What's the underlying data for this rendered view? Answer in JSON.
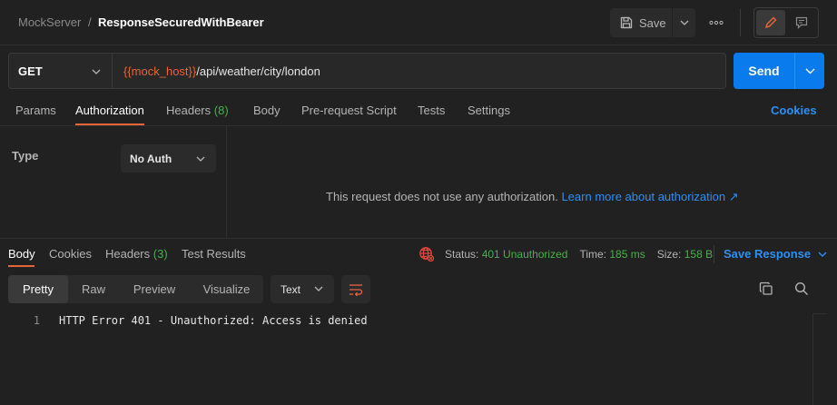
{
  "breadcrumb": {
    "parent": "MockServer",
    "separator": "/",
    "title": "ResponseSecuredWithBearer"
  },
  "header": {
    "save_label": "Save",
    "more_label": "∘∘∘"
  },
  "request": {
    "method": "GET",
    "url_variable": "{{mock_host}}",
    "url_path": "/api/weather/city/london",
    "send_label": "Send"
  },
  "request_tabs": {
    "params": "Params",
    "authorization": "Authorization",
    "headers": "Headers",
    "headers_count": "(8)",
    "body": "Body",
    "pre_request_script": "Pre-request Script",
    "tests": "Tests",
    "settings": "Settings",
    "cookies": "Cookies"
  },
  "auth": {
    "type_label": "Type",
    "type_value": "No Auth",
    "message": "This request does not use any authorization.",
    "learn_more": "Learn more about authorization ↗"
  },
  "response_tabs": {
    "body": "Body",
    "cookies": "Cookies",
    "headers": "Headers",
    "headers_count": "(3)",
    "test_results": "Test Results"
  },
  "response_status": {
    "status_label": "Status:",
    "status_value": "401 Unauthorized",
    "time_label": "Time:",
    "time_value": "185 ms",
    "size_label": "Size:",
    "size_value": "158 B",
    "save_response": "Save Response"
  },
  "format": {
    "pretty": "Pretty",
    "raw": "Raw",
    "preview": "Preview",
    "visualize": "Visualize",
    "language": "Text"
  },
  "response_body": {
    "lines": [
      {
        "number": "1",
        "text": "HTTP Error 401 - Unauthorized: Access is denied"
      }
    ]
  },
  "colors": {
    "accent": "#e8653a",
    "primary": "#097bed",
    "link": "#2d8ff2",
    "success": "#49b14b",
    "error_icon": "#e5463b",
    "background": "#212121"
  }
}
